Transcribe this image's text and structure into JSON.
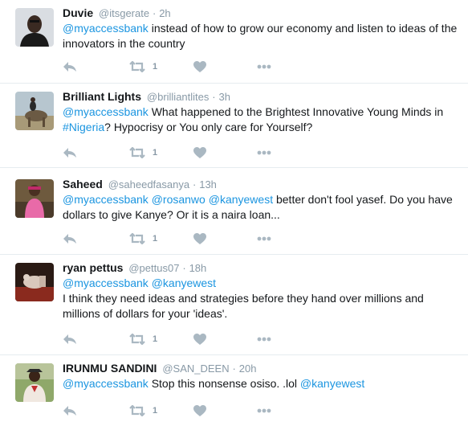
{
  "tweets": [
    {
      "name": "Duvie",
      "handle": "@itsgerate",
      "separator": "·",
      "time": "2h",
      "mention1": "@myaccessbank",
      "text1": " instead of how to grow our economy and listen to ideas of the innovators in the country",
      "retweets": "1"
    },
    {
      "name": "Brilliant Lights",
      "handle": "@brilliantlites",
      "separator": "·",
      "time": "3h",
      "mention1": "@myaccessbank",
      "text1": " What happened to the Brightest Innovative Young Minds in ",
      "hashtag": "#Nigeria",
      "text2": "? Hypocrisy or You only care for Yourself?",
      "retweets": "1"
    },
    {
      "name": "Saheed",
      "handle": "@saheedfasanya",
      "separator": "·",
      "time": "13h",
      "mention1": "@myaccessbank",
      "mention2": "@rosanwo",
      "mention3": "@kanyewest",
      "text1": " better don't fool yasef. Do you have dollars to give Kanye? Or it is a naira loan...",
      "retweets": "1"
    },
    {
      "name": "ryan pettus",
      "handle": "@pettus07",
      "separator": "·",
      "time": "18h",
      "mention1": "@myaccessbank",
      "mention2": "@kanyewest",
      "text1": "I think they need ideas and strategies before they hand over millions and millions of dollars for your 'ideas'.",
      "retweets": "1"
    },
    {
      "name": "IRUNMU SANDINI",
      "handle": "@SAN_DEEN",
      "separator": "·",
      "time": "20h",
      "mention1": "@myaccessbank",
      "text1": " Stop this nonsense osiso. .lol ",
      "mention2": "@kanyewest",
      "retweets": "1"
    }
  ],
  "colors": {
    "link": "#1b95e0",
    "muted": "#8899a6",
    "icon": "#aab8c2",
    "divider": "#e6ecf0"
  },
  "icons": {
    "reply": "reply-icon",
    "retweet": "retweet-icon",
    "like": "heart-icon",
    "more": "more-icon"
  }
}
